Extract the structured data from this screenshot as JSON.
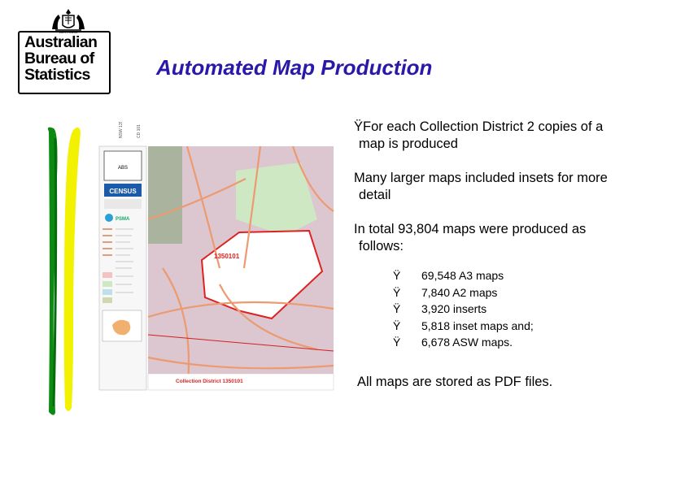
{
  "logo": {
    "lines": [
      "Australian",
      "Bureau of",
      "Statistics"
    ],
    "icon": "coat-of-arms-icon"
  },
  "title": "Automated Map Production",
  "map_image": {
    "icon": "census-map-icon",
    "district_label": "1350101",
    "footer_label": "Collection District 1350101",
    "brand": "CENSUS"
  },
  "content": {
    "bullet1": [
      "ŸFor each Collection District 2 copies of a",
      "map is produced"
    ],
    "bullet2": [
      "Many larger maps included insets for more",
      "detail"
    ],
    "bullet3": [
      "In total 93,804 maps were produced as",
      "follows:"
    ],
    "glyph": "Ÿ",
    "sub_items": [
      "69,548 A3 maps",
      "7,840 A2 maps",
      "3,920 inserts",
      "5,818 inset maps and;",
      "6,678 ASW maps."
    ],
    "final": "All maps are stored as PDF files."
  },
  "colors": {
    "title": "#2a19a8",
    "green_bar": "#0d8a12",
    "yellow_bar": "#f2f200"
  }
}
